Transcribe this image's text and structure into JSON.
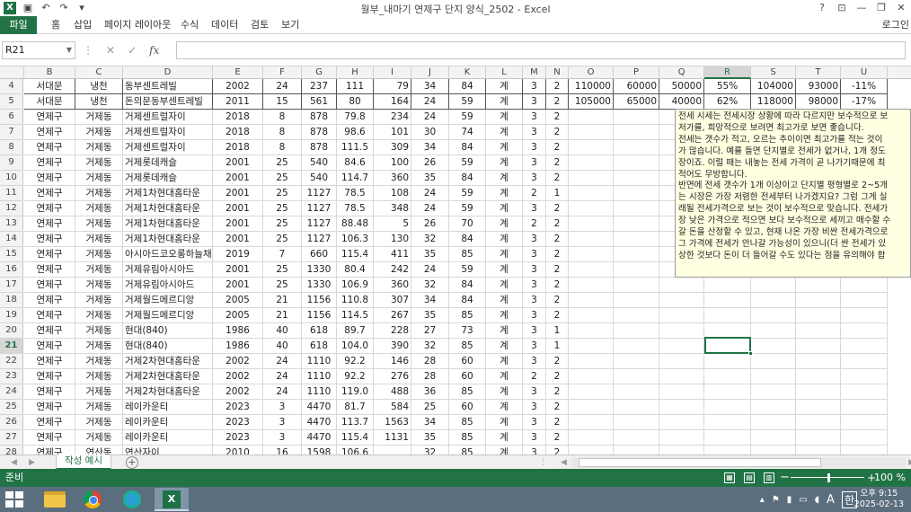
{
  "window": {
    "title": "월부_내마기 연제구 단지 양식_2502 - Excel",
    "buttons": [
      "?",
      "⊡",
      "—",
      "❐",
      "✕"
    ]
  },
  "qat_icons": [
    "save-icon",
    "undo-icon",
    "redo-icon",
    "customize-icon"
  ],
  "ribbon": {
    "file_tab": "파일",
    "tabs": [
      "홈",
      "삽입",
      "페이지 레이아웃",
      "수식",
      "데이터",
      "검토",
      "보기"
    ],
    "login": "로그인"
  },
  "formula_bar": {
    "name_box": "R21",
    "fx_label": "fx",
    "value": ""
  },
  "columns": [
    "B",
    "C",
    "D",
    "E",
    "F",
    "G",
    "H",
    "I",
    "J",
    "K",
    "L",
    "M",
    "N",
    "O",
    "P",
    "Q",
    "R",
    "S",
    "T",
    "U"
  ],
  "selected_column": "R",
  "selected_row": "21",
  "rows": [
    {
      "n": "4",
      "cells": [
        "서대문",
        "냉천",
        "동부센트레빌",
        "2002",
        "24",
        "237",
        "111",
        "79",
        "34",
        "84",
        "계",
        "3",
        "2",
        "110000",
        "60000",
        "50000",
        "55%",
        "104000",
        "93000",
        "-11%"
      ]
    },
    {
      "n": "5",
      "cells": [
        "서대문",
        "냉천",
        "돈의문동부센트레빌",
        "2011",
        "15",
        "561",
        "80",
        "164",
        "24",
        "59",
        "계",
        "3",
        "2",
        "105000",
        "65000",
        "40000",
        "62%",
        "118000",
        "98000",
        "-17%"
      ]
    },
    {
      "n": "6",
      "cells": [
        "연제구",
        "거제동",
        "거제센트럴자이",
        "2018",
        "8",
        "878",
        "79.8",
        "234",
        "24",
        "59",
        "계",
        "3",
        "2",
        "",
        "",
        "",
        "",
        "",
        "",
        ""
      ]
    },
    {
      "n": "7",
      "cells": [
        "연제구",
        "거제동",
        "거제센트럴자이",
        "2018",
        "8",
        "878",
        "98.6",
        "101",
        "30",
        "74",
        "계",
        "3",
        "2",
        "",
        "",
        "",
        "",
        "",
        "",
        ""
      ]
    },
    {
      "n": "8",
      "cells": [
        "연제구",
        "거제동",
        "거제센트럴자이",
        "2018",
        "8",
        "878",
        "111.5",
        "309",
        "34",
        "84",
        "계",
        "3",
        "2",
        "",
        "",
        "",
        "",
        "",
        "",
        ""
      ]
    },
    {
      "n": "9",
      "cells": [
        "연제구",
        "거제동",
        "거제롯데캐슬",
        "2001",
        "25",
        "540",
        "84.6",
        "100",
        "26",
        "59",
        "계",
        "3",
        "2",
        "",
        "",
        "",
        "",
        "",
        "",
        ""
      ]
    },
    {
      "n": "10",
      "cells": [
        "연제구",
        "거제동",
        "거제롯데캐슬",
        "2001",
        "25",
        "540",
        "114.7",
        "360",
        "35",
        "84",
        "계",
        "3",
        "2",
        "",
        "",
        "",
        "",
        "",
        "",
        ""
      ]
    },
    {
      "n": "11",
      "cells": [
        "연제구",
        "거제동",
        "거제1차현대홈타운",
        "2001",
        "25",
        "1127",
        "78.5",
        "108",
        "24",
        "59",
        "계",
        "2",
        "1",
        "",
        "",
        "",
        "",
        "",
        "",
        ""
      ]
    },
    {
      "n": "12",
      "cells": [
        "연제구",
        "거제동",
        "거제1차현대홈타운",
        "2001",
        "25",
        "1127",
        "78.5",
        "348",
        "24",
        "59",
        "계",
        "3",
        "2",
        "",
        "",
        "",
        "",
        "",
        "",
        ""
      ]
    },
    {
      "n": "13",
      "cells": [
        "연제구",
        "거제동",
        "거제1차현대홈타운",
        "2001",
        "25",
        "1127",
        "88.48",
        "5",
        "26",
        "70",
        "계",
        "2",
        "2",
        "",
        "",
        "",
        "",
        "",
        "",
        ""
      ]
    },
    {
      "n": "14",
      "cells": [
        "연제구",
        "거제동",
        "거제1차현대홈타운",
        "2001",
        "25",
        "1127",
        "106.3",
        "130",
        "32",
        "84",
        "계",
        "3",
        "2",
        "",
        "",
        "",
        "",
        "",
        "",
        ""
      ]
    },
    {
      "n": "15",
      "cells": [
        "연제구",
        "거제동",
        "아시아드코오롱하늘채",
        "2019",
        "7",
        "660",
        "115.4",
        "411",
        "35",
        "85",
        "계",
        "3",
        "2",
        "",
        "",
        "",
        "",
        "",
        "",
        ""
      ]
    },
    {
      "n": "16",
      "cells": [
        "연제구",
        "거제동",
        "거제유림아시아드",
        "2001",
        "25",
        "1330",
        "80.4",
        "242",
        "24",
        "59",
        "계",
        "3",
        "2",
        "",
        "",
        "",
        "",
        "",
        "",
        ""
      ]
    },
    {
      "n": "17",
      "cells": [
        "연제구",
        "거제동",
        "거제유림아시아드",
        "2001",
        "25",
        "1330",
        "106.9",
        "360",
        "32",
        "84",
        "계",
        "3",
        "2",
        "",
        "",
        "",
        "",
        "",
        "",
        ""
      ]
    },
    {
      "n": "18",
      "cells": [
        "연제구",
        "거제동",
        "거제월드메르디앙",
        "2005",
        "21",
        "1156",
        "110.8",
        "307",
        "34",
        "84",
        "계",
        "3",
        "2",
        "",
        "",
        "",
        "",
        "",
        "",
        ""
      ]
    },
    {
      "n": "19",
      "cells": [
        "연제구",
        "거제동",
        "거제월드메르디앙",
        "2005",
        "21",
        "1156",
        "114.5",
        "267",
        "35",
        "85",
        "계",
        "3",
        "2",
        "",
        "",
        "",
        "",
        "",
        "",
        ""
      ]
    },
    {
      "n": "20",
      "cells": [
        "연제구",
        "거제동",
        "현대(840)",
        "1986",
        "40",
        "618",
        "89.7",
        "228",
        "27",
        "73",
        "계",
        "3",
        "1",
        "",
        "",
        "",
        "",
        "",
        "",
        ""
      ]
    },
    {
      "n": "21",
      "cells": [
        "연제구",
        "거제동",
        "현대(840)",
        "1986",
        "40",
        "618",
        "104.0",
        "390",
        "32",
        "85",
        "계",
        "3",
        "1",
        "",
        "",
        "",
        "",
        "",
        "",
        ""
      ]
    },
    {
      "n": "22",
      "cells": [
        "연제구",
        "거제동",
        "거제2차현대홈타운",
        "2002",
        "24",
        "1110",
        "92.2",
        "146",
        "28",
        "60",
        "계",
        "3",
        "2",
        "",
        "",
        "",
        "",
        "",
        "",
        ""
      ]
    },
    {
      "n": "23",
      "cells": [
        "연제구",
        "거제동",
        "거제2차현대홈타운",
        "2002",
        "24",
        "1110",
        "92.2",
        "276",
        "28",
        "60",
        "계",
        "2",
        "2",
        "",
        "",
        "",
        "",
        "",
        "",
        ""
      ]
    },
    {
      "n": "24",
      "cells": [
        "연제구",
        "거제동",
        "거제2차현대홈타운",
        "2002",
        "24",
        "1110",
        "119.0",
        "488",
        "36",
        "85",
        "계",
        "3",
        "2",
        "",
        "",
        "",
        "",
        "",
        "",
        ""
      ]
    },
    {
      "n": "25",
      "cells": [
        "연제구",
        "거제동",
        "레이카운티",
        "2023",
        "3",
        "4470",
        "81.7",
        "584",
        "25",
        "60",
        "계",
        "3",
        "2",
        "",
        "",
        "",
        "",
        "",
        "",
        ""
      ]
    },
    {
      "n": "26",
      "cells": [
        "연제구",
        "거제동",
        "레이카운티",
        "2023",
        "3",
        "4470",
        "113.7",
        "1563",
        "34",
        "85",
        "계",
        "3",
        "2",
        "",
        "",
        "",
        "",
        "",
        "",
        ""
      ]
    },
    {
      "n": "27",
      "cells": [
        "연제구",
        "거제동",
        "레이카운티",
        "2023",
        "3",
        "4470",
        "115.4",
        "1131",
        "35",
        "85",
        "계",
        "3",
        "2",
        "",
        "",
        "",
        "",
        "",
        "",
        ""
      ]
    },
    {
      "n": "28",
      "cells": [
        "연제구",
        "연산동",
        "연산자이",
        "2010",
        "16",
        "1598",
        "106.6",
        "",
        "32",
        "85",
        "계",
        "3",
        "2",
        "",
        "",
        "",
        "",
        "",
        "",
        ""
      ]
    }
  ],
  "comment": {
    "lines": [
      "전세 시세는 전세시장 상황에 따라 다르지만 보수적으로 보",
      "저가를, 희망적으로 보려면 최고가로 보면 좋습니다.",
      "전세는 갯수가 적고, 오르는 추이이면 최고가를 적는 것이",
      "가 많습니다. 예를 들면 단지별로 전세가 없거나, 1개 정도",
      "장이죠. 이럴 때는 내놓는 전세 가격이 곧 나가기때문에 최",
      "적어도 무방합니다.",
      "반면에 전세 갯수가 1개 이상이고 단지별 평형별로 2~5개",
      "는 시장은 가장 저렴한 전세부터 나가겠지요? 그럼 그게 실",
      "래될 전세가격으로 보는 것이 보수적으로 맞습니다. 전세가",
      "장 낮은 가격으로 적으면 보다 보수적으로 세끼고 매수할 수",
      "갈 돈을 산정할 수 있고, 현재 나온 가장 비싼 전세가격으로",
      "그 가격에 전세가 안나갈 가능성이 있으니(더 싼 전세가 있",
      "상한 것보다 돈이 더 들어갈 수도 있다는 점을 유의해야 합"
    ]
  },
  "sheet_tabs": {
    "active": "작성 예시",
    "add_label": "+"
  },
  "status": {
    "ready": "준비",
    "zoom": "100 %"
  },
  "taskbar": {
    "apps": [
      "file-explorer",
      "chrome",
      "edge",
      "excel"
    ],
    "ime": "A",
    "ime2": "한",
    "time": "오후 9:15",
    "date": "2025-02-13"
  }
}
